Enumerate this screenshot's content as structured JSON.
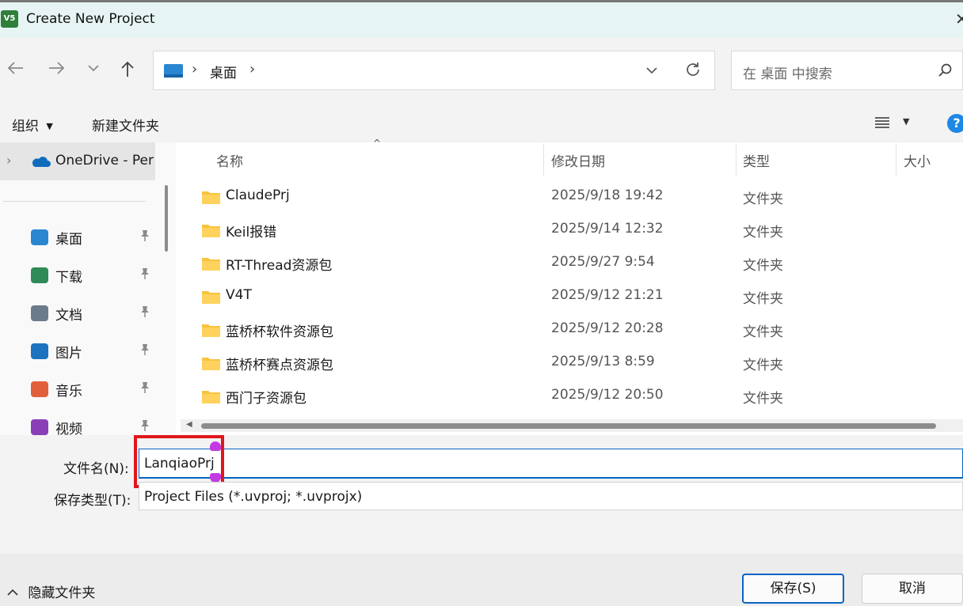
{
  "window": {
    "title": "Create New Project",
    "app_icon_text": "V5"
  },
  "nav": {
    "address": {
      "location": "桌面",
      "sep": "›"
    },
    "search": {
      "placeholder": "在 桌面 中搜索"
    }
  },
  "toolbar": {
    "organize": "组织",
    "new_folder": "新建文件夹"
  },
  "sidebar": {
    "onedrive": "OneDrive - Per",
    "items": [
      {
        "label": "桌面",
        "icon": "desktop-icon",
        "color": "#2a86d1"
      },
      {
        "label": "下载",
        "icon": "download-icon",
        "color": "#2e8b57"
      },
      {
        "label": "文档",
        "icon": "document-icon",
        "color": "#6b7b8c"
      },
      {
        "label": "图片",
        "icon": "pictures-icon",
        "color": "#1e73be"
      },
      {
        "label": "音乐",
        "icon": "music-icon",
        "color": "#e0603b"
      },
      {
        "label": "视频",
        "icon": "video-icon",
        "color": "#8a3fb7"
      }
    ]
  },
  "columns": {
    "name": "名称",
    "date": "修改日期",
    "type": "类型",
    "size": "大小"
  },
  "files": [
    {
      "name": "ClaudePrj",
      "date": "2025/9/18 19:42",
      "type": "文件夹"
    },
    {
      "name": "Keil报错",
      "date": "2025/9/14 12:32",
      "type": "文件夹"
    },
    {
      "name": "RT-Thread资源包",
      "date": "2025/9/27 9:54",
      "type": "文件夹"
    },
    {
      "name": "V4T",
      "date": "2025/9/12 21:21",
      "type": "文件夹"
    },
    {
      "name": "蓝桥杯软件资源包",
      "date": "2025/9/12 20:28",
      "type": "文件夹"
    },
    {
      "name": "蓝桥杯赛点资源包",
      "date": "2025/9/13 8:59",
      "type": "文件夹"
    },
    {
      "name": "西门子资源包",
      "date": "2025/9/12 20:50",
      "type": "文件夹"
    }
  ],
  "form": {
    "filename_label": "文件名(N):",
    "filename_value": "LanqiaoPrj",
    "filetype_label": "保存类型(T):",
    "filetype_value": "Project Files (*.uvproj; *.uvprojx)"
  },
  "footer": {
    "hide_folders": "隐藏文件夹",
    "save": "保存(S)",
    "cancel": "取消"
  },
  "colors": {
    "highlight": "#e0161b",
    "accent": "#0067c0",
    "folder": "#f8c33d",
    "title_bg": "#e6f5f4"
  }
}
